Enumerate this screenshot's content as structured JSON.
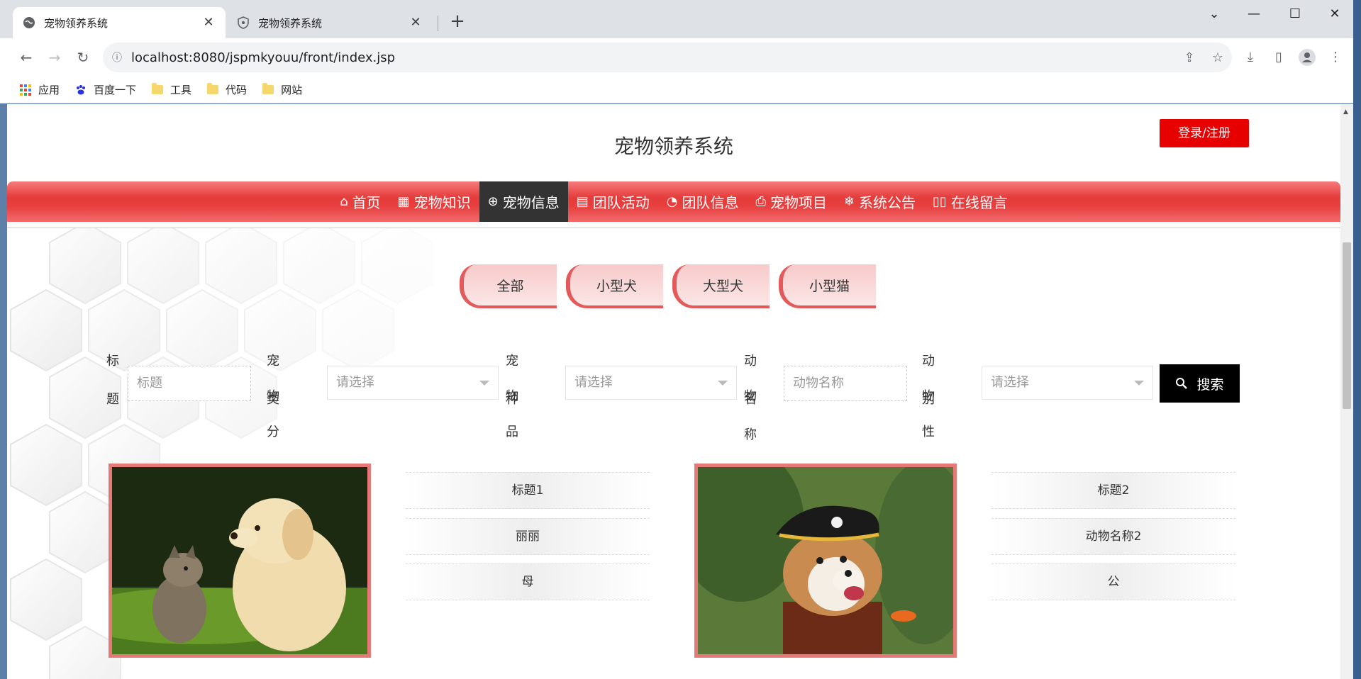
{
  "browser": {
    "tabs": [
      {
        "title": "宠物领养系统",
        "active": true
      },
      {
        "title": "宠物领养系统",
        "active": false
      }
    ],
    "url": "localhost:8080/jspmkyouu/front/index.jsp",
    "bookmarks": [
      {
        "label": "应用",
        "icon": "apps-grid-icon"
      },
      {
        "label": "百度一下",
        "icon": "baidu-paw-icon"
      },
      {
        "label": "工具",
        "icon": "folder-icon"
      },
      {
        "label": "代码",
        "icon": "folder-icon"
      },
      {
        "label": "网站",
        "icon": "folder-icon"
      }
    ]
  },
  "site": {
    "title": "宠物领养系统",
    "login_label": "登录/注册",
    "nav": [
      {
        "label": "首页",
        "icon": "home-icon",
        "active": false
      },
      {
        "label": "宠物知识",
        "icon": "grid-icon",
        "active": false
      },
      {
        "label": "宠物信息",
        "icon": "globe-icon",
        "active": true
      },
      {
        "label": "团队活动",
        "icon": "calendar-icon",
        "active": false
      },
      {
        "label": "团队信息",
        "icon": "palette-icon",
        "active": false
      },
      {
        "label": "宠物项目",
        "icon": "printer-icon",
        "active": false
      },
      {
        "label": "系统公告",
        "icon": "snowflake-icon",
        "active": false
      },
      {
        "label": "在线留言",
        "icon": "book-icon",
        "active": false
      }
    ]
  },
  "categories": [
    "全部",
    "小型犬",
    "大型犬",
    "小型猫"
  ],
  "search": {
    "title_label_1": "标",
    "title_label_2": "题",
    "title_placeholder": "标题",
    "category_label_1": "宠物分",
    "category_label_2": "类",
    "category_placeholder": "请选择",
    "breed_label_1": "宠物品",
    "breed_label_2": "种",
    "breed_placeholder": "请选择",
    "name_label_1": "动物",
    "name_label_2": "名称",
    "name_placeholder": "动物名称",
    "gender_label_1": "动物性",
    "gender_label_2": "别",
    "gender_placeholder": "请选择",
    "button_label": "搜索"
  },
  "pets": [
    {
      "title": "标题1",
      "name": "丽丽",
      "gender": "母",
      "image": "puppy-and-kitten-photo"
    },
    {
      "title": "标题2",
      "name": "动物名称2",
      "gender": "公",
      "image": "pirate-corgi-photo"
    }
  ],
  "colors": {
    "accent_red": "#e60000",
    "nav_red": "#e53b3b",
    "nav_active": "#333333",
    "card_border": "#e77878"
  }
}
